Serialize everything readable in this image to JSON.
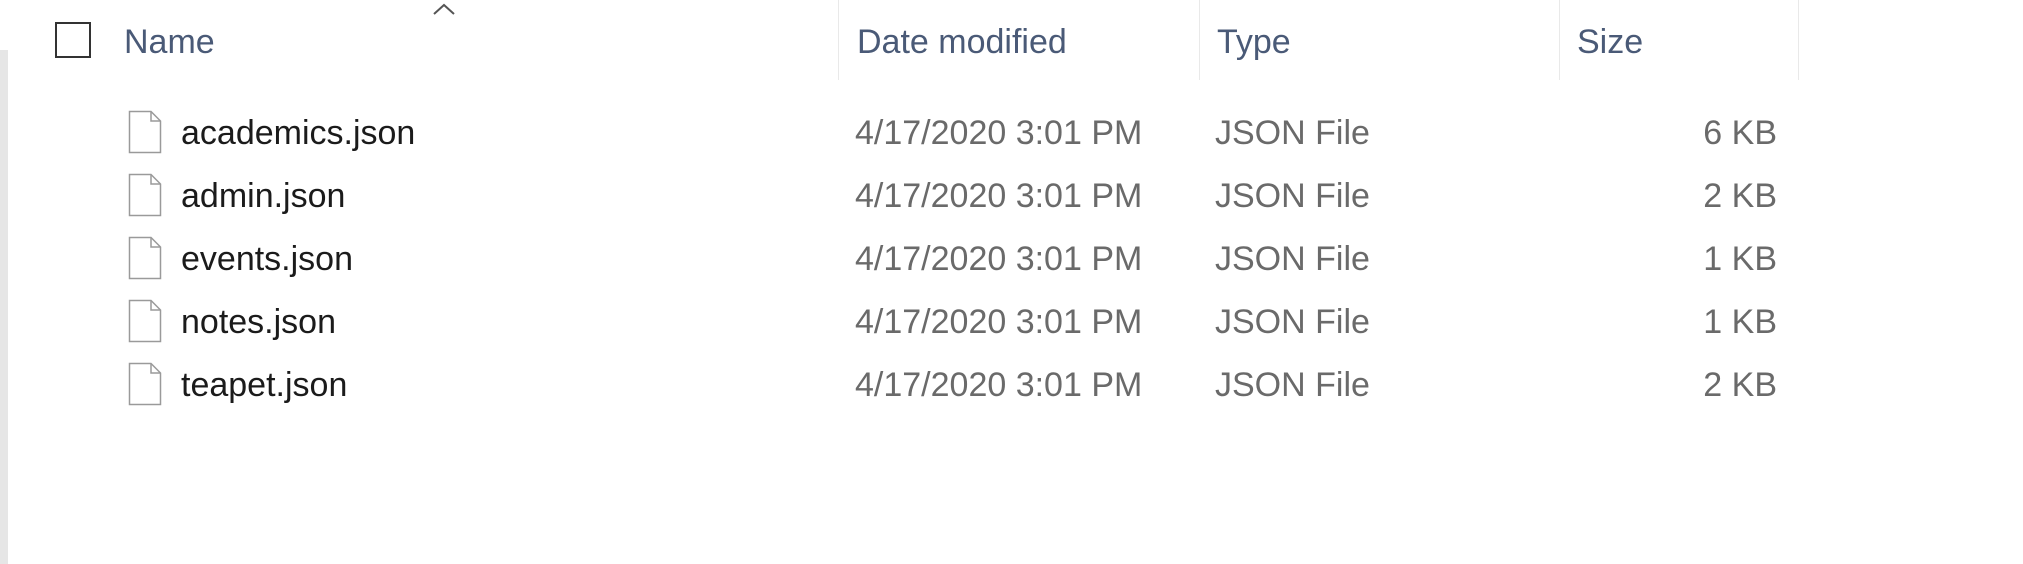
{
  "columns": {
    "name": "Name",
    "date_modified": "Date modified",
    "type": "Type",
    "size": "Size"
  },
  "sort": {
    "column": "name",
    "direction": "ascending",
    "icon": "chevron-up-icon"
  },
  "files": [
    {
      "name": "academics.json",
      "date_modified": "4/17/2020 3:01 PM",
      "type": "JSON File",
      "size": "6 KB",
      "icon": "file-icon"
    },
    {
      "name": "admin.json",
      "date_modified": "4/17/2020 3:01 PM",
      "type": "JSON File",
      "size": "2 KB",
      "icon": "file-icon"
    },
    {
      "name": "events.json",
      "date_modified": "4/17/2020 3:01 PM",
      "type": "JSON File",
      "size": "1 KB",
      "icon": "file-icon"
    },
    {
      "name": "notes.json",
      "date_modified": "4/17/2020 3:01 PM",
      "type": "JSON File",
      "size": "1 KB",
      "icon": "file-icon"
    },
    {
      "name": "teapet.json",
      "date_modified": "4/17/2020 3:01 PM",
      "type": "JSON File",
      "size": "2 KB",
      "icon": "file-icon"
    }
  ],
  "colors": {
    "header_text": "#4a5a77",
    "name_text": "#1b1b1b",
    "detail_text": "#6a6a6a",
    "divider": "#e9e9e9"
  }
}
